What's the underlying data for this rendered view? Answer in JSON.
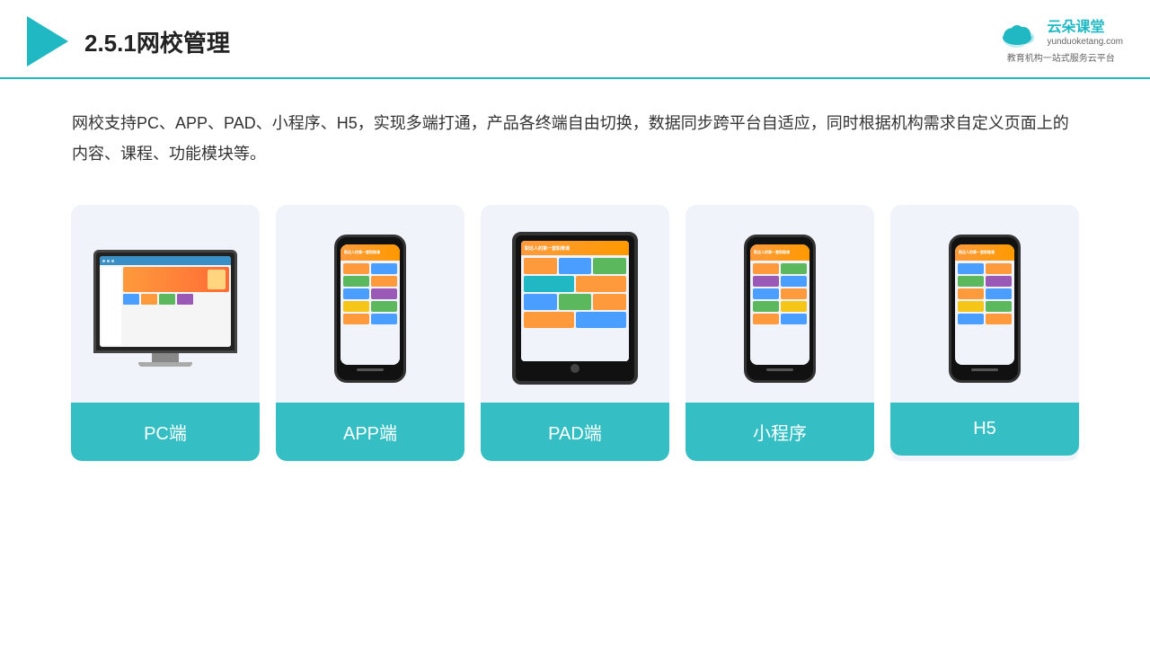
{
  "header": {
    "title": "2.5.1网校管理",
    "logo_main": "云朵课堂",
    "logo_url": "yunduoketang.com",
    "logo_sub1": "教育机构一站",
    "logo_sub2": "式服务云平台"
  },
  "description": {
    "text": "网校支持PC、APP、PAD、小程序、H5，实现多端打通，产品各终端自由切换，数据同步跨平台自适应，同时根据机构需求自定义页面上的内容、课程、功能模块等。"
  },
  "cards": [
    {
      "id": "pc",
      "label": "PC端"
    },
    {
      "id": "app",
      "label": "APP端"
    },
    {
      "id": "pad",
      "label": "PAD端"
    },
    {
      "id": "miniprogram",
      "label": "小程序"
    },
    {
      "id": "h5",
      "label": "H5"
    }
  ],
  "colors": {
    "teal": "#35bfc4",
    "dark_teal": "#1fb8c3",
    "border_bottom": "#1fb8c3",
    "card_bg": "#f0f4fa",
    "text_main": "#333",
    "text_title": "#222"
  }
}
